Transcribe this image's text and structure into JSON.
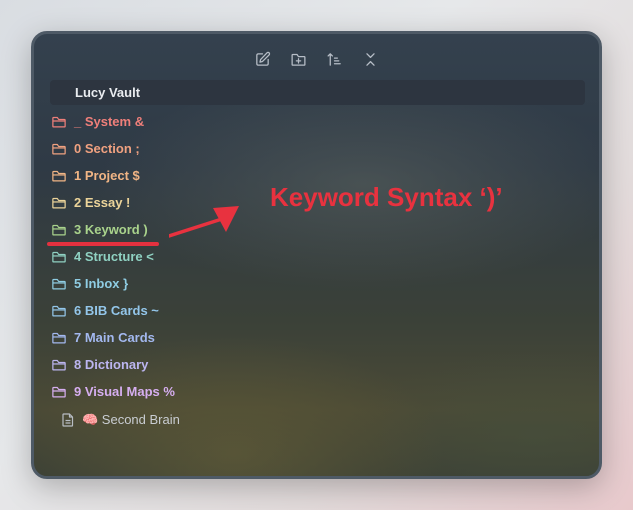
{
  "toolbar": {
    "buttons": [
      {
        "name": "new-note-icon"
      },
      {
        "name": "new-folder-icon"
      },
      {
        "name": "sort-icon"
      },
      {
        "name": "collapse-all-icon"
      }
    ],
    "icon_color": "#b7bec7"
  },
  "vault": {
    "name": "Lucy Vault"
  },
  "folders": [
    {
      "label": "_ System &",
      "color": "#ef7f7a"
    },
    {
      "label": "0 Section ;",
      "color": "#f0a180"
    },
    {
      "label": "1 Project $",
      "color": "#f1b585"
    },
    {
      "label": "2 Essay !",
      "color": "#ecd49a"
    },
    {
      "label": "3 Keyword )",
      "color": "#a9d38c"
    },
    {
      "label": "4 Structure <",
      "color": "#8fd1c2"
    },
    {
      "label": "5 Inbox }",
      "color": "#8fcde3"
    },
    {
      "label": "6 BIB Cards ~",
      "color": "#93c6ea"
    },
    {
      "label": "7 Main Cards",
      "color": "#a3b8ef"
    },
    {
      "label": "8 Dictionary",
      "color": "#bcb5f0"
    },
    {
      "label": "9 Visual Maps %",
      "color": "#d6aef0"
    }
  ],
  "file": {
    "label": "🧠 Second Brain",
    "icon": "file-icon"
  },
  "annotation": {
    "text": "Keyword Syntax ‘)’",
    "color": "#e8323f"
  }
}
